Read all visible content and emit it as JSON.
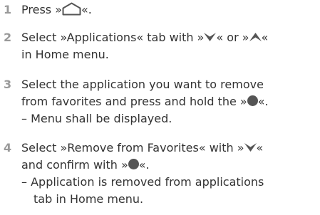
{
  "steps": [
    {
      "number": "1",
      "lines": [
        {
          "before": "Press »",
          "after": "«."
        }
      ]
    },
    {
      "number": "2",
      "lines": [
        {
          "a": "Select »Applications« tab with »",
          "b": "« or »",
          "c": "«"
        },
        {
          "text": "in Home menu."
        }
      ]
    },
    {
      "number": "3",
      "lines": [
        {
          "text": "Select the application you want to remove"
        },
        {
          "before": "from favorites and press and hold the »",
          "after": "«."
        },
        {
          "text": "– Menu shall be displayed."
        }
      ]
    },
    {
      "number": "4",
      "lines": [
        {
          "before": "Select »Remove from Favorites« with »",
          "after": "«"
        },
        {
          "before": "and confirm with »",
          "after": "«."
        },
        {
          "text": "– Application is removed from applications"
        },
        {
          "text": "tab in Home menu."
        }
      ]
    }
  ],
  "icons": {
    "home": "home-icon",
    "down": "down-arrow-icon",
    "up": "up-arrow-icon",
    "ok": "ok-button-icon"
  },
  "colors": {
    "text": "#333333",
    "step_number": "#999999",
    "glyph": "#555555"
  }
}
